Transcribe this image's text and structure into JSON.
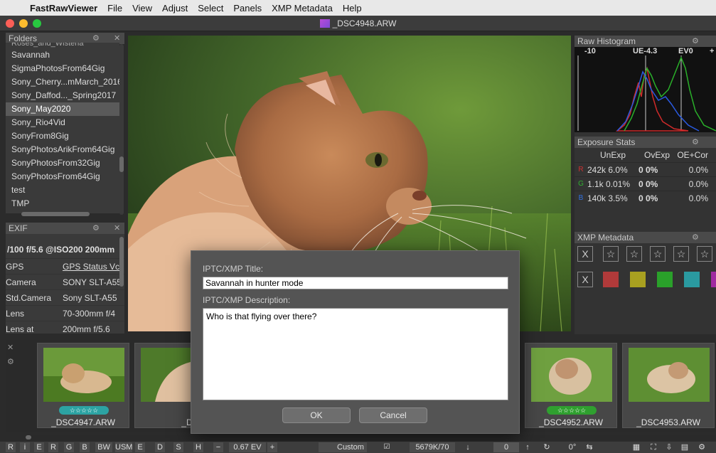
{
  "menubar": {
    "app_name": "FastRawViewer",
    "items": [
      "File",
      "View",
      "Adjust",
      "Select",
      "Panels",
      "XMP Metadata",
      "Help"
    ]
  },
  "window": {
    "title": "_DSC4948.ARW"
  },
  "folders_panel": {
    "title": "Folders",
    "cut_item": "Roses_and_Wisteria",
    "items": [
      {
        "label": "Savannah",
        "selected": false
      },
      {
        "label": "SigmaPhotosFrom64Gig",
        "selected": false
      },
      {
        "label": "Sony_Cherry...mMarch_2016",
        "selected": false
      },
      {
        "label": "Sony_Daffod..._Spring2017",
        "selected": false
      },
      {
        "label": "Sony_May2020",
        "selected": true
      },
      {
        "label": "Sony_Rio4Vid",
        "selected": false
      },
      {
        "label": "SonyFrom8Gig",
        "selected": false
      },
      {
        "label": "SonyPhotosArikFrom64Gig",
        "selected": false
      },
      {
        "label": "SonyPhotosFrom32Gig",
        "selected": false
      },
      {
        "label": "SonyPhotosFrom64Gig",
        "selected": false
      },
      {
        "label": "test",
        "selected": false
      },
      {
        "label": "TMP",
        "selected": false
      }
    ]
  },
  "exif_panel": {
    "title": "EXIF",
    "summary": "/100 f/5.6 @ISO200 200mm",
    "rows": [
      {
        "key": "GPS",
        "value": "GPS Status Vc"
      },
      {
        "key": "Camera",
        "value": "SONY SLT-A55"
      },
      {
        "key": "Std.Camera",
        "value": "Sony SLT-A55"
      },
      {
        "key": "Lens",
        "value": "70-300mm f/4"
      },
      {
        "key": "Lens at",
        "value": "200mm f/5.6"
      }
    ]
  },
  "histogram": {
    "title": "Raw Histogram",
    "labels": [
      "-10",
      "UE-4.3",
      "EV0",
      "+"
    ]
  },
  "exposure_stats": {
    "title": "Exposure Stats",
    "headers": [
      "UnExp",
      "OvExp",
      "OE+Cor"
    ],
    "rows": [
      {
        "channel": "R",
        "color": "#d03030",
        "unexp": "242k 6.0%",
        "ovexp": "0 0%",
        "oecor": "0.0%"
      },
      {
        "channel": "G",
        "color": "#30b030",
        "unexp": "1.1k 0.01%",
        "ovexp": "0 0%",
        "oecor": "0.0%"
      },
      {
        "channel": "B",
        "color": "#3070e0",
        "unexp": "140k 3.5%",
        "ovexp": "0 0%",
        "oecor": "0.0%"
      }
    ]
  },
  "xmp_panel": {
    "title": "XMP Metadata",
    "reject": "X",
    "star": "☆",
    "label_colors": [
      "#b03a3a",
      "#a8a020",
      "#2aa02a",
      "#2a9aa0",
      "#a02aa0"
    ]
  },
  "filmstrip": {
    "thumbs": [
      {
        "name": "_DSC4947.ARW",
        "stars": "☆☆☆☆☆",
        "star_color": "teal"
      },
      {
        "name": "_DSC4948",
        "stars": "",
        "star_color": ""
      },
      {
        "name": "_DSC4952.ARW",
        "stars": "☆☆☆☆☆",
        "star_color": "green"
      },
      {
        "name": "_DSC4953.ARW",
        "stars": "",
        "star_color": ""
      }
    ]
  },
  "dialog": {
    "title_label": "IPTC/XMP Title:",
    "title_value": "Savannah in hunter mode",
    "desc_label": "IPTC/XMP Description:",
    "desc_value": "Who is that flying over there?",
    "ok": "OK",
    "cancel": "Cancel"
  },
  "toolbar": {
    "channels": [
      "R",
      "i",
      "E",
      "R",
      "G",
      "B",
      "BW",
      "USM",
      "E",
      "D",
      "S",
      "H"
    ],
    "ev_minus": "−",
    "ev_value": "0.67 EV",
    "ev_plus": "+",
    "wb_preset": "Custom",
    "wb_value": "5679K/70",
    "rotate_value": "0",
    "angle_value": "0°"
  }
}
